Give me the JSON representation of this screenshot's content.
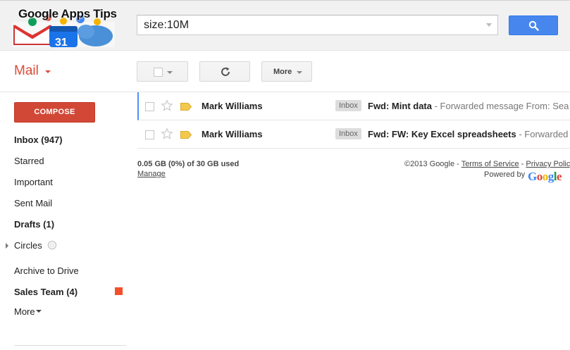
{
  "header": {
    "logo_title": "Google Apps Tips",
    "search_value": "size:10M"
  },
  "toolbar": {
    "app_label": "Mail",
    "more_label": "More"
  },
  "sidebar": {
    "compose_label": "COMPOSE",
    "items": [
      {
        "label": "Inbox (947)"
      },
      {
        "label": "Starred"
      },
      {
        "label": "Important"
      },
      {
        "label": "Sent Mail"
      },
      {
        "label": "Drafts (1)"
      },
      {
        "label": "Circles"
      },
      {
        "label": "Archive to Drive"
      },
      {
        "label": "Sales Team (4)",
        "color": "#f2502b"
      },
      {
        "label": "More"
      }
    ]
  },
  "messages": [
    {
      "sender": "Mark Williams",
      "tag": "Inbox",
      "subject": "Fwd: Mint data",
      "snippet": " - Forwarded message From: Sea"
    },
    {
      "sender": "Mark Williams",
      "tag": "Inbox",
      "subject": "Fwd: FW: Key Excel spreadsheets",
      "snippet": " - Forwarded"
    }
  ],
  "footer": {
    "usage": "0.05 GB (0%) of 30 GB used",
    "manage": "Manage",
    "copyright": "©2013 Google - ",
    "terms": "Terms of Service",
    "separator": " - ",
    "privacy": "Privacy Policy",
    "powered_by": "Powered by",
    "google_word": "Google"
  },
  "colors": {
    "accent_red": "#dd4b39",
    "compose_bg": "#d14836",
    "search_blue": "#4787ed",
    "label_sales_team": "#f2502b"
  }
}
